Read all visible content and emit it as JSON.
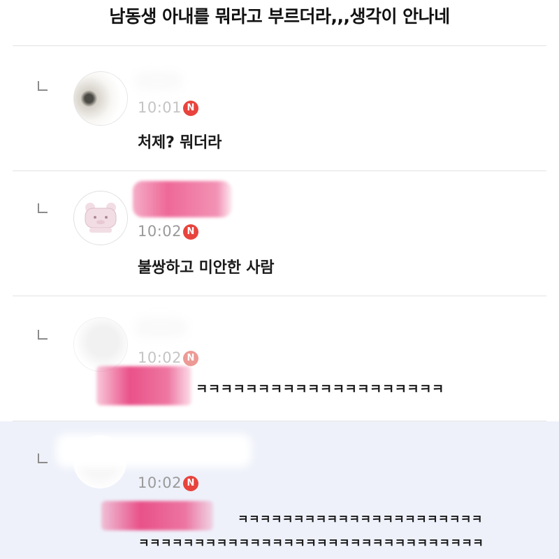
{
  "post": {
    "title": "남동생 아내를 뭐라고 부르더라,,,생각이 안나네"
  },
  "comments": [
    {
      "time": "10:01",
      "badge": "N",
      "text": "처제? 뭐더라"
    },
    {
      "time": "10:02",
      "badge": "N",
      "text": "불쌍하고 미안한 사람"
    },
    {
      "time": "10:02",
      "badge": "N",
      "text_suffix": "ㅋㅋㅋㅋㅋㅋㅋㅋㅋㅋㅋㅋㅋㅋㅋㅋㅋㅋㅋㅋ"
    },
    {
      "time": "10:02",
      "badge": "N",
      "text_line1": "ㅋㅋㅋㅋㅋㅋㅋㅋㅋㅋㅋㅋㅋㅋㅋㅋㅋㅋㅋㅋㅋㅋ",
      "text_line2": "ㅋㅋㅋㅋㅋㅋㅋㅋㅋㅋㅋㅋㅋㅋㅋㅋㅋㅋㅋㅋㅋㅋㅋㅋㅋㅋㅋㅋㅋㅋㅋ"
    }
  ],
  "colors": {
    "badge": "#e8433d",
    "highlight_row": "#eef1fa",
    "redaction": "#ec5a8e"
  },
  "icons": {
    "reply": "reply-arrow-icon",
    "new": "new-badge-icon"
  }
}
